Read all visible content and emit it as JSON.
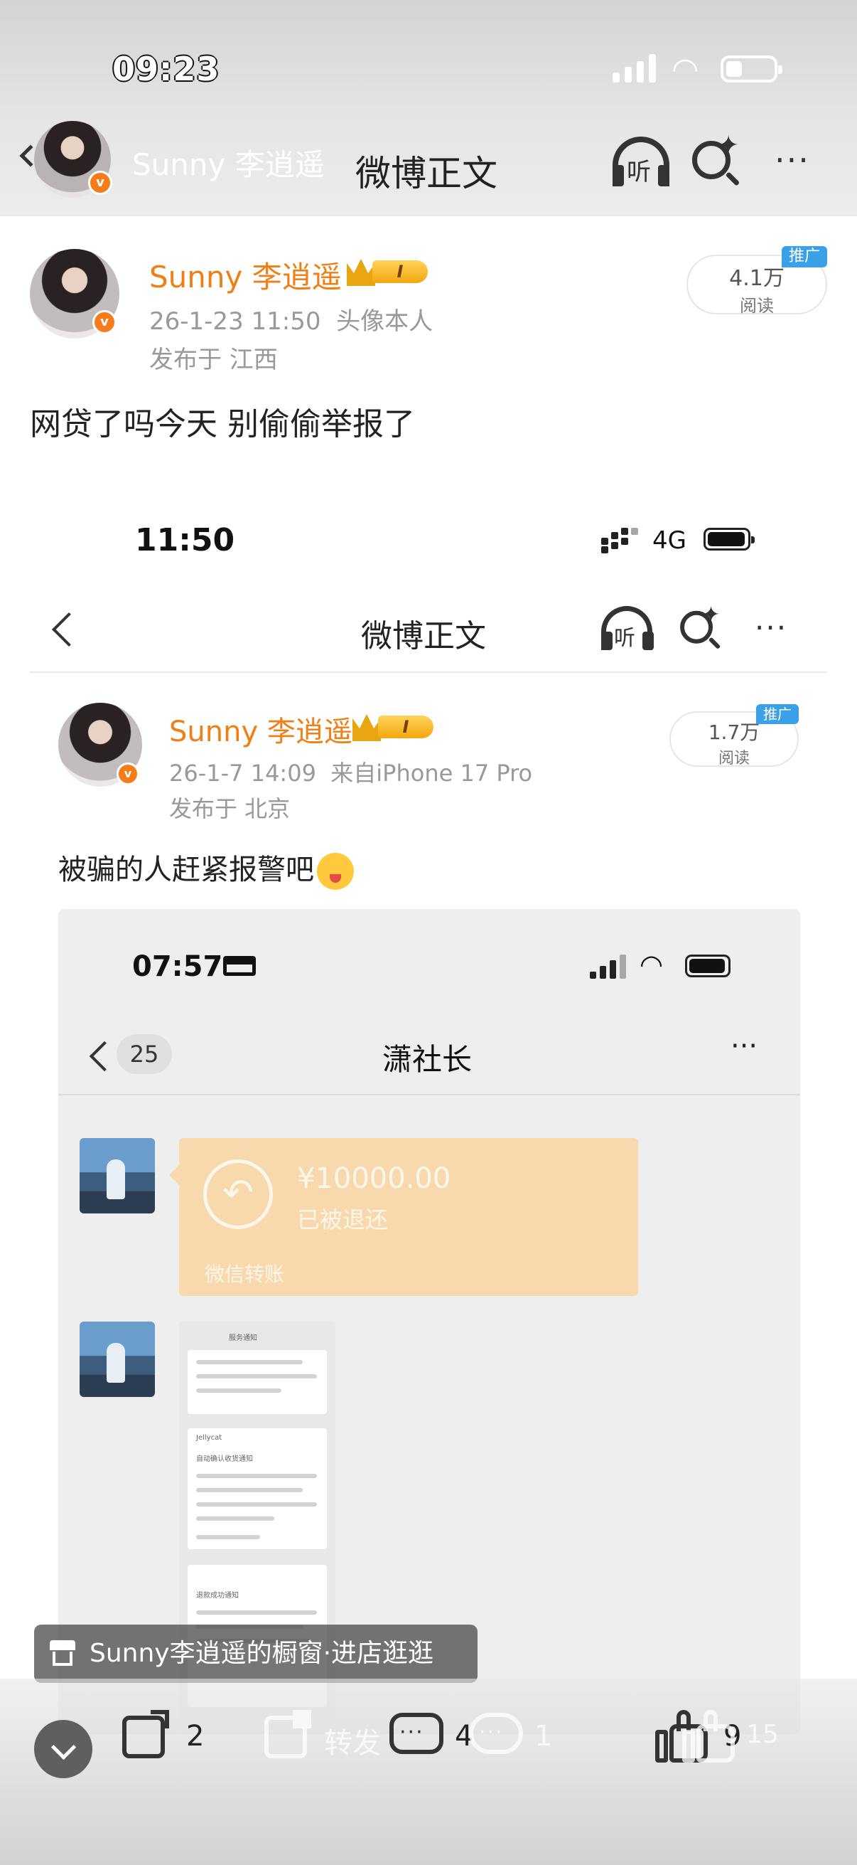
{
  "status_bar": {
    "time": "09:23"
  },
  "header": {
    "user_name": "Sunny 李逍遥",
    "title": "微博正文",
    "listen_label": "听",
    "more": "···"
  },
  "post": {
    "author": "Sunny 李逍遥",
    "level_badge": "I",
    "timestamp": "26-1-23 11:50",
    "source": "头像本人",
    "location": "发布于 江西",
    "reads_count": "4.1万",
    "reads_label": "阅读",
    "promo_tag": "推广",
    "text": "网贷了吗今天 别偷偷举报了"
  },
  "embedded": {
    "status_time": "11:50",
    "network": "4G",
    "title": "微博正文",
    "listen_label": "听",
    "more": "···",
    "author": "Sunny 李逍遥",
    "level_badge": "I",
    "timestamp": "26-1-7 14:09",
    "source": "来自iPhone 17 Pro",
    "location": "发布于 北京",
    "reads_count": "1.7万",
    "reads_label": "阅读",
    "promo_tag": "推广",
    "text": "被骗的人赶紧报警吧"
  },
  "chat": {
    "status_time": "07:57",
    "unread": "25",
    "title": "潇社长",
    "more": "···",
    "transfer": {
      "amount": "¥10000.00",
      "status": "已被退还",
      "footer": "微信转账",
      "icon": "return-arrow-icon"
    },
    "thumbnail": {
      "header": "服务通知",
      "brand": "Jellycat",
      "card_title": "自动确认收货通知",
      "refund_title": "退款成功通知"
    }
  },
  "shop_banner": {
    "text": "Sunny李逍遥的橱窗·进店逛逛"
  },
  "actions": {
    "share_count": "2",
    "repost_label": "转发",
    "comment_count": "4",
    "comment_overlay_count": "1",
    "like_count": "9",
    "like_overlay_count": "15"
  },
  "colors": {
    "brand_orange": "#f07f16",
    "promo_blue": "#3aa0e8",
    "transfer_bg": "#f7d9ad"
  }
}
